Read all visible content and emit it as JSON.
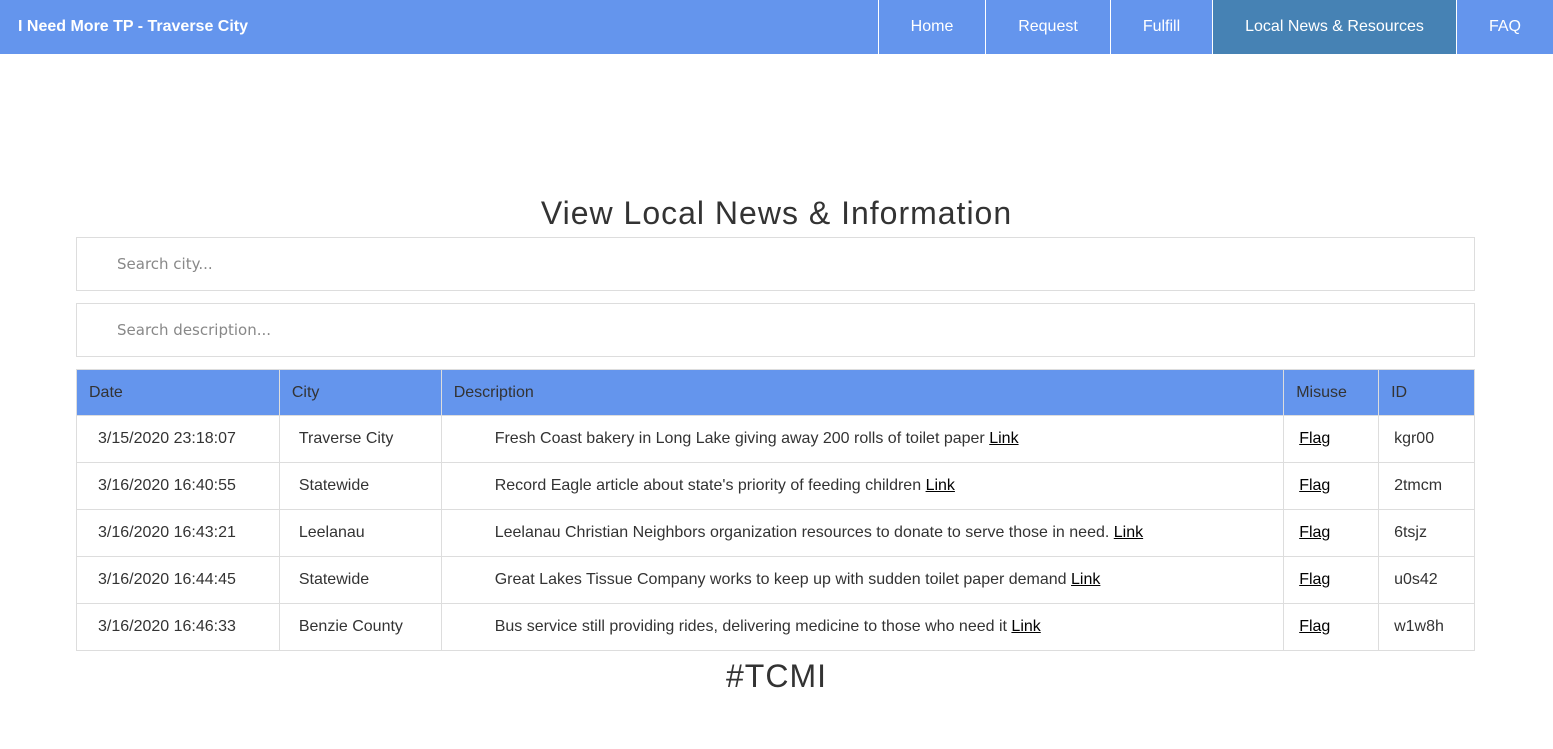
{
  "navbar": {
    "brand": "I Need More TP - Traverse City",
    "items": [
      {
        "label": "Home",
        "active": false
      },
      {
        "label": "Request",
        "active": false
      },
      {
        "label": "Fulfill",
        "active": false
      },
      {
        "label": "Local News & Resources",
        "active": true
      },
      {
        "label": "FAQ",
        "active": false
      }
    ]
  },
  "main": {
    "title": "View Local News & Information",
    "search_city_placeholder": "Search city...",
    "search_desc_placeholder": "Search description...",
    "table": {
      "headers": [
        "Date",
        "City",
        "Description",
        "Misuse",
        "ID"
      ],
      "rows": [
        {
          "date": "3/15/2020 23:18:07",
          "city": "Traverse City",
          "description": "Fresh Coast bakery in Long Lake giving away 200 rolls of toilet paper",
          "link": "Link",
          "flag": "Flag",
          "id": "kgr00"
        },
        {
          "date": "3/16/2020 16:40:55",
          "city": "Statewide",
          "description": "Record Eagle article about state's priority of feeding children",
          "link": "Link",
          "flag": "Flag",
          "id": "2tmcm"
        },
        {
          "date": "3/16/2020 16:43:21",
          "city": "Leelanau",
          "description": "Leelanau Christian Neighbors organization resources to donate to serve those in need.",
          "link": "Link",
          "flag": "Flag",
          "id": "6tsjz"
        },
        {
          "date": "3/16/2020 16:44:45",
          "city": "Statewide",
          "description": "Great Lakes Tissue Company works to keep up with sudden toilet paper demand",
          "link": "Link",
          "flag": "Flag",
          "id": "u0s42"
        },
        {
          "date": "3/16/2020 16:46:33",
          "city": "Benzie County",
          "description": "Bus service still providing rides, delivering medicine to those who need it",
          "link": "Link",
          "flag": "Flag",
          "id": "w1w8h"
        }
      ]
    },
    "footer_tag": "#TCMI"
  },
  "colors": {
    "nav_bg": "#6495ED",
    "nav_active_bg": "#4682B4",
    "table_header_bg": "#6495ED",
    "border": "#dddddd"
  }
}
